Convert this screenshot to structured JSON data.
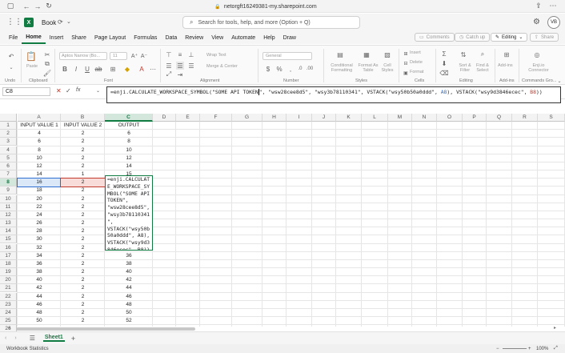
{
  "browser": {
    "url": "netorgft16249381-my.sharepoint.com"
  },
  "titlebar": {
    "app_logo": "X",
    "book_name": "Book",
    "search_placeholder": "Search for tools, help, and more (Option + Q)",
    "avatar_initials": "VB"
  },
  "menu": {
    "items": [
      "File",
      "Home",
      "Insert",
      "Share",
      "Page Layout",
      "Formulas",
      "Data",
      "Review",
      "View",
      "Automate",
      "Help",
      "Draw"
    ],
    "comments": "Comments",
    "catch_up": "Catch up",
    "editing": "Editing",
    "share": "Share"
  },
  "ribbon": {
    "undo": "Undo",
    "paste": "Paste",
    "clipboard": "Clipboard",
    "font_name": "Aptos Narrow (Bo...",
    "font_size": "11",
    "font": "Font",
    "wrap_text": "Wrap Text",
    "merge_center": "Merge & Center",
    "alignment": "Alignment",
    "number_format": "General",
    "number": "Number",
    "conditional_formatting": "Conditional Formatting",
    "format_as_table": "Format As Table",
    "cell_styles": "Cell Styles",
    "styles": "Styles",
    "insert": "Insert",
    "delete": "Delete",
    "format": "Format",
    "cells": "Cells",
    "sort_filter": "Sort & Filter",
    "find_select": "Find & Select",
    "editing": "Editing",
    "add_ins": "Add-ins",
    "add_ins_group": "Add-ins",
    "enji_connector": "Enji.io Connector",
    "commands_group": "Commands Gro..."
  },
  "formula_bar": {
    "name_box": "C8",
    "fx": "fx",
    "formula_part1": "=enji.CALCULATE_WORKSPACE_SYMBOL(\"SOME API TOKEN",
    "formula_part2": "\", \"wsw28cee8d5\", \"wsy3b78110341\", VSTACK(\"wsy50b50a0ddd\", ",
    "formula_ref1": "A8",
    "formula_part3": "), VSTACK(\"wsy9d3846ecec\", ",
    "formula_ref2": "B8",
    "formula_part4": "))"
  },
  "grid": {
    "columns": [
      "A",
      "B",
      "C",
      "D",
      "E",
      "F",
      "G",
      "H",
      "I",
      "J",
      "K",
      "L",
      "M",
      "N",
      "O",
      "P",
      "Q",
      "R",
      "S"
    ],
    "headers": [
      "INPUT VALUE 1",
      "INPUT VALUE 2",
      "OUTPUT"
    ],
    "rows": [
      [
        "4",
        "2",
        "6"
      ],
      [
        "6",
        "2",
        "8"
      ],
      [
        "8",
        "2",
        "10"
      ],
      [
        "10",
        "2",
        "12"
      ],
      [
        "12",
        "2",
        "14"
      ],
      [
        "14",
        "1",
        "15"
      ],
      [
        "16",
        "2",
        ""
      ],
      [
        "18",
        "2",
        ""
      ],
      [
        "20",
        "2",
        ""
      ],
      [
        "22",
        "2",
        ""
      ],
      [
        "24",
        "2",
        ""
      ],
      [
        "26",
        "2",
        ""
      ],
      [
        "28",
        "2",
        ""
      ],
      [
        "30",
        "2",
        ""
      ],
      [
        "32",
        "2",
        ""
      ],
      [
        "34",
        "2",
        "36"
      ],
      [
        "36",
        "2",
        "38"
      ],
      [
        "38",
        "2",
        "40"
      ],
      [
        "40",
        "2",
        "42"
      ],
      [
        "42",
        "2",
        "44"
      ],
      [
        "44",
        "2",
        "46"
      ],
      [
        "46",
        "2",
        "48"
      ],
      [
        "48",
        "2",
        "50"
      ],
      [
        "50",
        "2",
        "52"
      ]
    ],
    "row_numbers": [
      "1",
      "2",
      "3",
      "4",
      "5",
      "6",
      "7",
      "8",
      "9",
      "10",
      "11",
      "12",
      "13",
      "14",
      "15",
      "16",
      "17",
      "18",
      "19",
      "20",
      "21",
      "22",
      "23",
      "24",
      "25",
      "26"
    ],
    "edit_text": "=enji.CALCULAT\nE_WORKSPACE_SY\nMBOL(\"SOME API\nTOKEN\",\n\"wsw28cee8d5\",\n\"wsy3b78110341\n\",\nVSTACK(\"wsy50b\n50a0ddd\", A8),\nVSTACK(\"wsy9d3\n846ecec\", B8))"
  },
  "sheets": {
    "active": "Sheet1"
  },
  "status": {
    "left": "Workbook Statistics",
    "zoom": "100%"
  },
  "colors": {
    "accent": "#107c41",
    "ref_blue": "#2f6fd1",
    "ref_red": "#c0392b"
  }
}
